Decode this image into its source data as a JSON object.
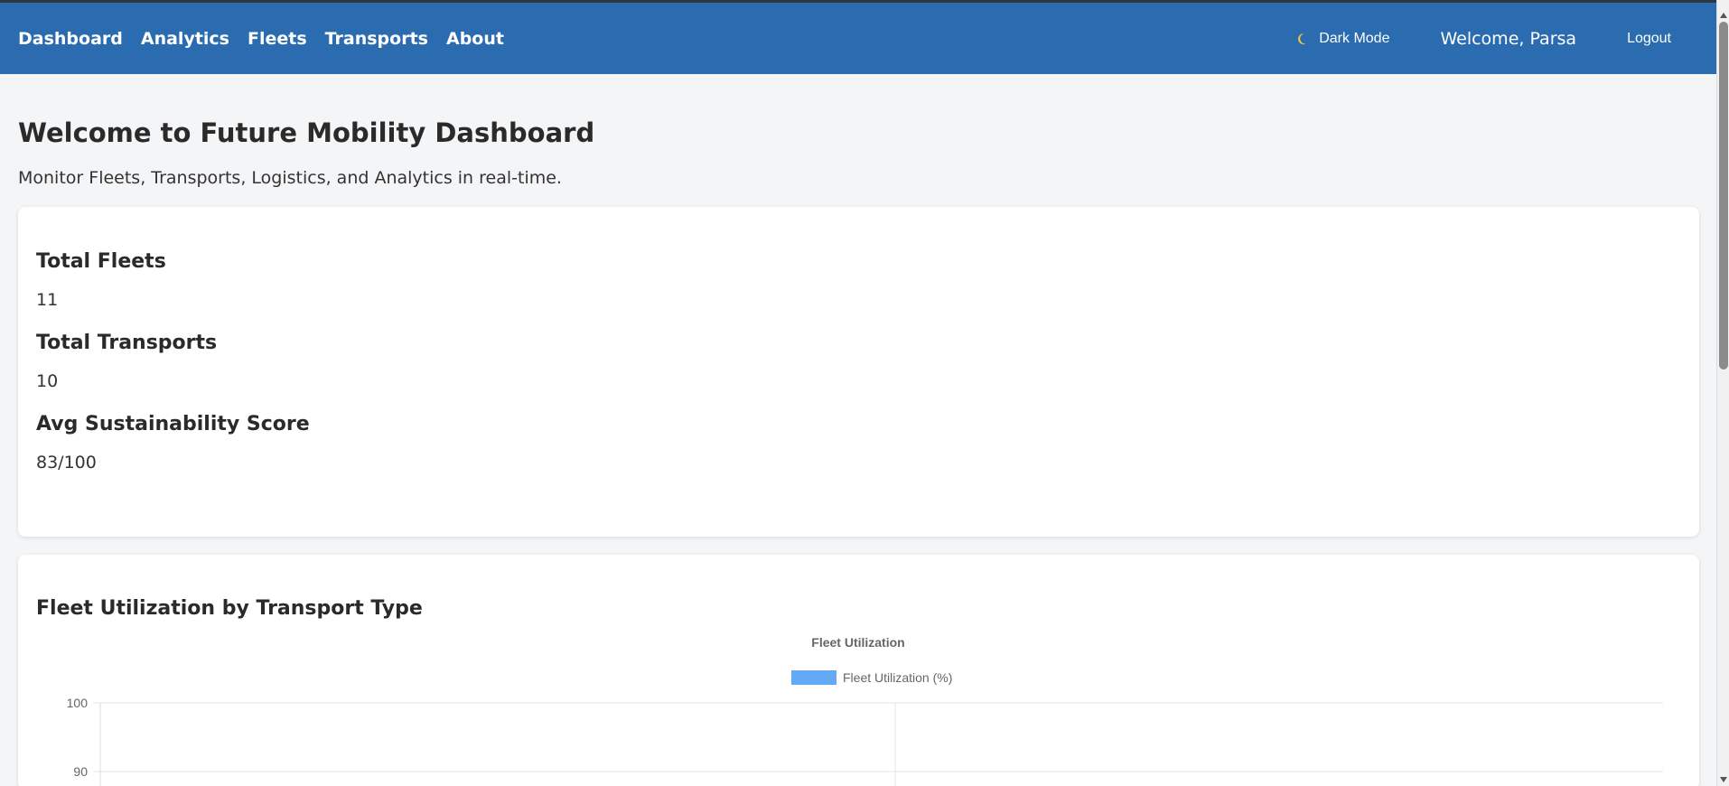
{
  "nav": {
    "links": [
      "Dashboard",
      "Analytics",
      "Fleets",
      "Transports",
      "About"
    ],
    "dark_mode_label": "Dark Mode",
    "moon_icon": "moon-icon",
    "welcome": "Welcome, Parsa",
    "logout_label": "Logout"
  },
  "header": {
    "title": "Welcome to Future Mobility Dashboard",
    "subtitle": "Monitor Fleets, Transports, Logistics, and Analytics in real-time."
  },
  "stats": [
    {
      "label": "Total Fleets",
      "value": "11"
    },
    {
      "label": "Total Transports",
      "value": "10"
    },
    {
      "label": "Avg Sustainability Score",
      "value": "83/100"
    }
  ],
  "chart_section": {
    "heading": "Fleet Utilization by Transport Type"
  },
  "chart_data": {
    "type": "bar",
    "title": "Fleet Utilization",
    "series": [
      {
        "name": "Fleet Utilization (%)",
        "values": []
      }
    ],
    "legend_placement": "top",
    "visible_y_ticks": [
      100,
      90
    ],
    "ylim": [
      null,
      100
    ],
    "grid": true,
    "colors": {
      "series": "#63a9f5"
    }
  }
}
